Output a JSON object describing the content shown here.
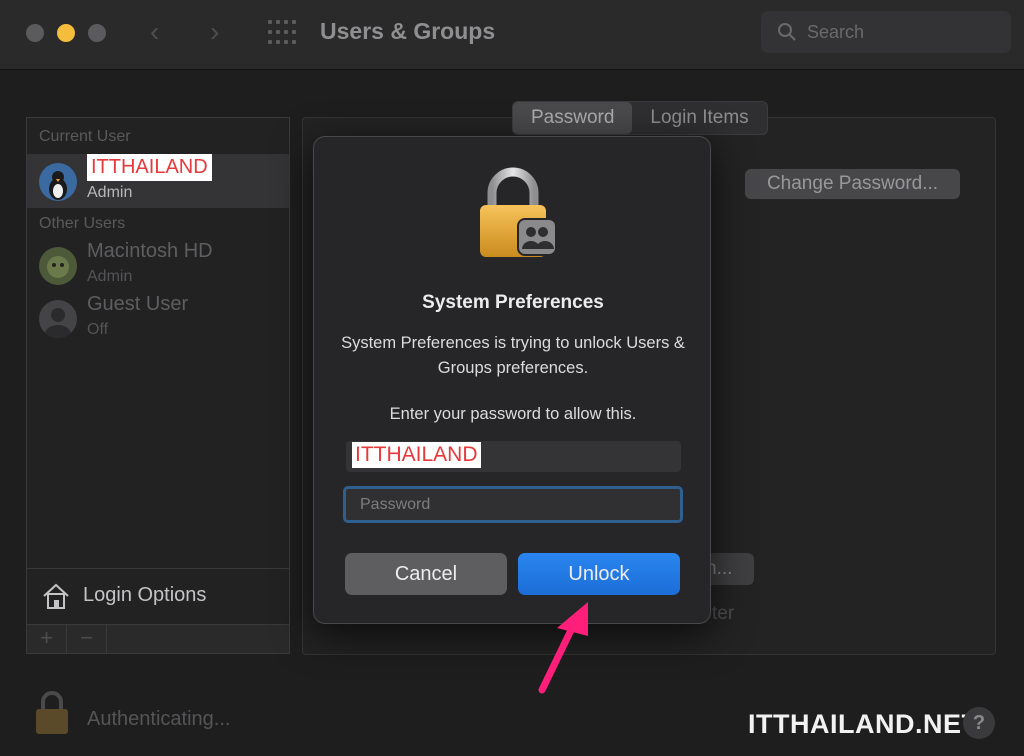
{
  "window": {
    "title": "Users & Groups",
    "search_placeholder": "Search"
  },
  "sidebar": {
    "current_user_header": "Current User",
    "current_user": {
      "name": "ITTHAILAND",
      "role": "Admin"
    },
    "other_users_header": "Other Users",
    "other_users": [
      {
        "name": "Macintosh HD",
        "role": "Admin"
      },
      {
        "name": "Guest User",
        "role": "Off"
      }
    ],
    "login_options_label": "Login Options",
    "add_label": "+",
    "remove_label": "−"
  },
  "content": {
    "tabs": [
      "Password",
      "Login Items"
    ],
    "change_password_label": "Change Password...",
    "obscured_button_label": "n...",
    "obscured_text": "ter"
  },
  "footer": {
    "status_text": "Authenticating...",
    "help_label": "?",
    "watermark": "ITTHAILAND.NET"
  },
  "dialog": {
    "title": "System Preferences",
    "message": "System Preferences is trying to unlock Users & Groups preferences.",
    "prompt": "Enter your password to allow this.",
    "username_value": "ITTHAILAND",
    "password_placeholder": "Password",
    "cancel_label": "Cancel",
    "unlock_label": "Unlock"
  },
  "colors": {
    "accent_blue": "#1c6dd6",
    "annotation_arrow": "#ff1f7a",
    "redaction_text": "#e6393b"
  }
}
